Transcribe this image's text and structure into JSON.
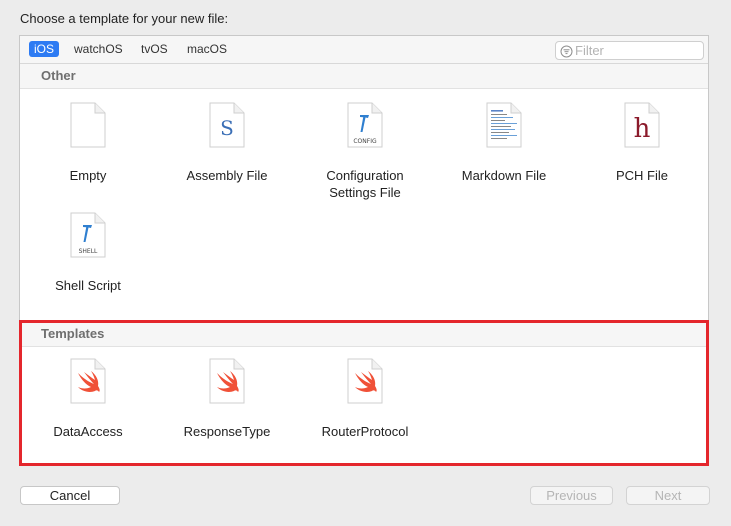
{
  "dialog": {
    "title": "Choose a template for your new file:"
  },
  "tabs": [
    {
      "label": "iOS",
      "selected": true
    },
    {
      "label": "watchOS",
      "selected": false
    },
    {
      "label": "tvOS",
      "selected": false
    },
    {
      "label": "macOS",
      "selected": false
    }
  ],
  "filter": {
    "placeholder": "Filter",
    "icon": "filter-icon"
  },
  "sections": {
    "other": {
      "title": "Other",
      "items": [
        {
          "label": "Empty",
          "icon": "blank-document-icon"
        },
        {
          "label": "Assembly File",
          "icon": "assembly-document-icon",
          "glyph": "S"
        },
        {
          "label": "Configuration Settings File",
          "label_lines": [
            "Configuration",
            "Settings File"
          ],
          "icon": "config-document-icon",
          "badge": "CONFIG"
        },
        {
          "label": "Markdown File",
          "icon": "markdown-document-icon"
        },
        {
          "label": "PCH File",
          "icon": "pch-document-icon",
          "glyph": "h"
        },
        {
          "label": "Shell Script",
          "icon": "shell-document-icon",
          "badge": "SHELL"
        }
      ]
    },
    "templates": {
      "title": "Templates",
      "items": [
        {
          "label": "DataAccess",
          "icon": "swift-document-icon"
        },
        {
          "label": "ResponseType",
          "icon": "swift-document-icon"
        },
        {
          "label": "RouterProtocol",
          "icon": "swift-document-icon"
        }
      ]
    }
  },
  "buttons": {
    "cancel": "Cancel",
    "previous": "Previous",
    "next": "Next"
  },
  "colors": {
    "selection": "#2d7bf3",
    "highlight_border": "#e4262c",
    "swift": "#f05138",
    "pch": "#8b1a2b",
    "assembly": "#3b6fb6"
  }
}
